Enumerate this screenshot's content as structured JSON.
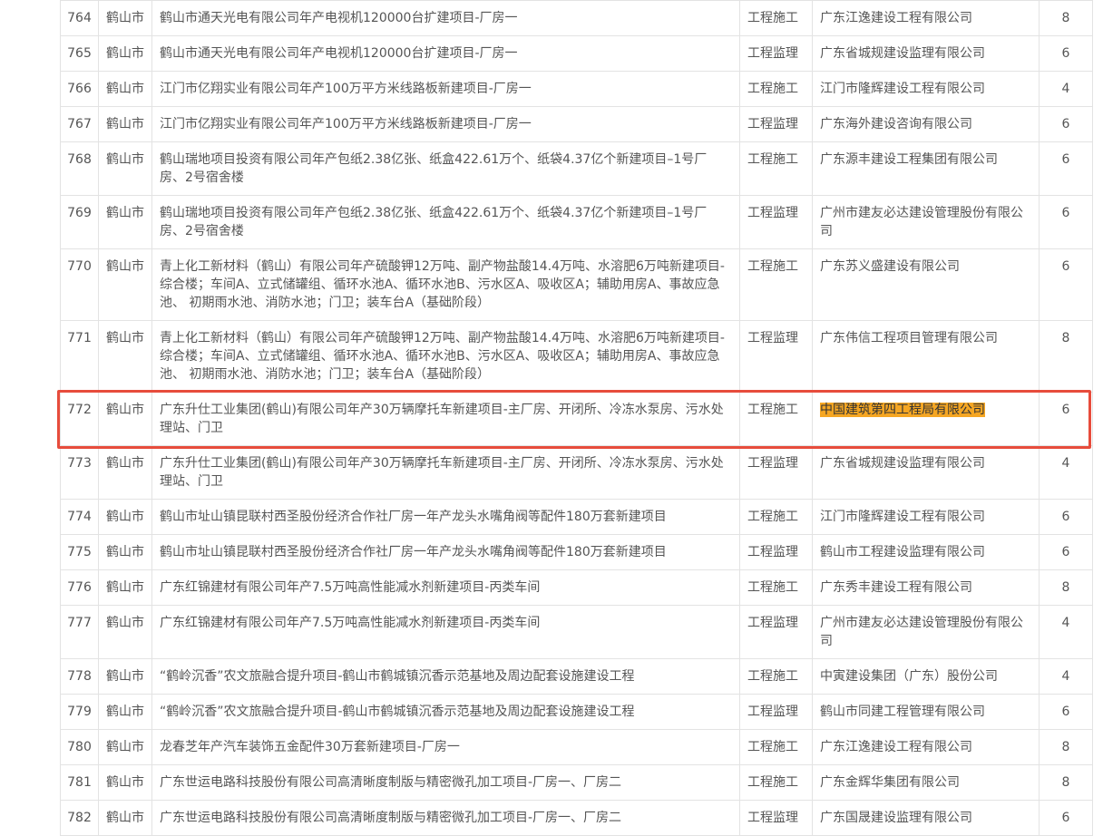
{
  "colors": {
    "highlight_bg": "#f5a623",
    "highlight_border": "#e74c3c"
  },
  "rows": [
    {
      "no": "764",
      "city": "鹤山市",
      "project": "鹤山市通天光电有限公司年产电视机120000台扩建项目-厂房一",
      "type": "工程施工",
      "company": "广东江逸建设工程有限公司",
      "score": "8"
    },
    {
      "no": "765",
      "city": "鹤山市",
      "project": "鹤山市通天光电有限公司年产电视机120000台扩建项目-厂房一",
      "type": "工程监理",
      "company": "广东省城规建设监理有限公司",
      "score": "6"
    },
    {
      "no": "766",
      "city": "鹤山市",
      "project": "江门市亿翔实业有限公司年产100万平方米线路板新建项目-厂房一",
      "type": "工程施工",
      "company": "江门市隆辉建设工程有限公司",
      "score": "4"
    },
    {
      "no": "767",
      "city": "鹤山市",
      "project": "江门市亿翔实业有限公司年产100万平方米线路板新建项目-厂房一",
      "type": "工程监理",
      "company": "广东海外建设咨询有限公司",
      "score": "6"
    },
    {
      "no": "768",
      "city": "鹤山市",
      "project": "鹤山瑞地项目投资有限公司年产包纸2.38亿张、纸盒422.61万个、纸袋4.37亿个新建项目–1号厂房、2号宿舍楼",
      "type": "工程施工",
      "company": "广东源丰建设工程集团有限公司",
      "score": "6"
    },
    {
      "no": "769",
      "city": "鹤山市",
      "project": "鹤山瑞地项目投资有限公司年产包纸2.38亿张、纸盒422.61万个、纸袋4.37亿个新建项目–1号厂房、2号宿舍楼",
      "type": "工程监理",
      "company": "广州市建友必达建设管理股份有限公司",
      "score": "6"
    },
    {
      "no": "770",
      "city": "鹤山市",
      "project": "青上化工新材料（鹤山）有限公司年产硫酸钾12万吨、副产物盐酸14.4万吨、水溶肥6万吨新建项目-综合楼；车间A、立式储罐组、循环水池A、循环水池B、污水区A、吸收区A；辅助用房A、事故应急池、 初期雨水池、消防水池；门卫；装车台A（基础阶段）",
      "type": "工程施工",
      "company": "广东苏义盛建设有限公司",
      "score": "6"
    },
    {
      "no": "771",
      "city": "鹤山市",
      "project": "青上化工新材料（鹤山）有限公司年产硫酸钾12万吨、副产物盐酸14.4万吨、水溶肥6万吨新建项目-综合楼；车间A、立式储罐组、循环水池A、循环水池B、污水区A、吸收区A；辅助用房A、事故应急池、 初期雨水池、消防水池；门卫；装车台A（基础阶段）",
      "type": "工程监理",
      "company": "广东伟信工程项目管理有限公司",
      "score": "8"
    },
    {
      "no": "772",
      "city": "鹤山市",
      "project": "广东升仕工业集团(鹤山)有限公司年产30万辆摩托车新建项目-主厂房、开闭所、冷冻水泵房、污水处理站、门卫",
      "type": "工程施工",
      "company": "中国建筑第四工程局有限公司",
      "score": "6",
      "highlight": true
    },
    {
      "no": "773",
      "city": "鹤山市",
      "project": "广东升仕工业集团(鹤山)有限公司年产30万辆摩托车新建项目-主厂房、开闭所、冷冻水泵房、污水处理站、门卫",
      "type": "工程监理",
      "company": "广东省城规建设监理有限公司",
      "score": "4"
    },
    {
      "no": "774",
      "city": "鹤山市",
      "project": "鹤山市址山镇昆联村西圣股份经济合作社厂房一年产龙头水嘴角阀等配件180万套新建项目",
      "type": "工程施工",
      "company": "江门市隆辉建设工程有限公司",
      "score": "6"
    },
    {
      "no": "775",
      "city": "鹤山市",
      "project": "鹤山市址山镇昆联村西圣股份经济合作社厂房一年产龙头水嘴角阀等配件180万套新建项目",
      "type": "工程监理",
      "company": "鹤山市工程建设监理有限公司",
      "score": "6"
    },
    {
      "no": "776",
      "city": "鹤山市",
      "project": "广东红锦建材有限公司年产7.5万吨高性能减水剂新建项目-丙类车间",
      "type": "工程施工",
      "company": "广东秀丰建设工程有限公司",
      "score": "8"
    },
    {
      "no": "777",
      "city": "鹤山市",
      "project": "广东红锦建材有限公司年产7.5万吨高性能减水剂新建项目-丙类车间",
      "type": "工程监理",
      "company": "广州市建友必达建设管理股份有限公司",
      "score": "4"
    },
    {
      "no": "778",
      "city": "鹤山市",
      "project": "“鹤岭沉香”农文旅融合提升项目-鹤山市鹤城镇沉香示范基地及周边配套设施建设工程",
      "type": "工程施工",
      "company": "中寅建设集团（广东）股份公司",
      "score": "4"
    },
    {
      "no": "779",
      "city": "鹤山市",
      "project": "“鹤岭沉香”农文旅融合提升项目-鹤山市鹤城镇沉香示范基地及周边配套设施建设工程",
      "type": "工程监理",
      "company": "鹤山市同建工程管理有限公司",
      "score": "6"
    },
    {
      "no": "780",
      "city": "鹤山市",
      "project": "龙春芝年产汽车装饰五金配件30万套新建项目-厂房一",
      "type": "工程施工",
      "company": "广东江逸建设工程有限公司",
      "score": "8"
    },
    {
      "no": "781",
      "city": "鹤山市",
      "project": "广东世运电路科技股份有限公司高清晰度制版与精密微孔加工项目-厂房一、厂房二",
      "type": "工程施工",
      "company": "广东金辉华集团有限公司",
      "score": "8"
    },
    {
      "no": "782",
      "city": "鹤山市",
      "project": "广东世运电路科技股份有限公司高清晰度制版与精密微孔加工项目-厂房一、厂房二",
      "type": "工程监理",
      "company": "广东国晟建设监理有限公司",
      "score": "6"
    }
  ]
}
